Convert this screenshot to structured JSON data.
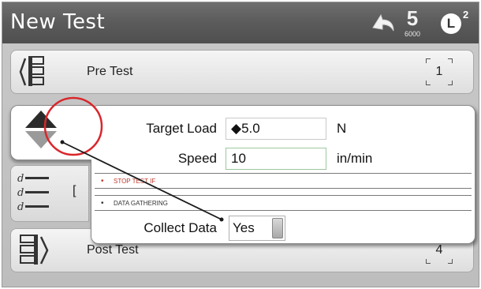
{
  "header": {
    "title": "New Test",
    "undo_icon": "undo-arrow-icon",
    "sg_icon": {
      "glyph": "5",
      "subtext": "6000"
    },
    "login": {
      "letter": "L",
      "level": "2"
    }
  },
  "sections": {
    "pre_test": {
      "label": "Pre Test",
      "count": "1",
      "icon": "pre-test-icon"
    },
    "data": {
      "clipped_label": "[",
      "icon": "data-lines-icon"
    },
    "post_test": {
      "label": "Post Test",
      "count": "4",
      "icon": "post-test-icon"
    }
  },
  "popup": {
    "target_load": {
      "label": "Target Load",
      "value": "◆5.0",
      "unit": "N"
    },
    "speed": {
      "label": "Speed",
      "value": "10",
      "unit": "in/min"
    },
    "stop_test_if": "STOP TEST IF",
    "data_gathering": "DATA GATHERING",
    "collect_data": {
      "label": "Collect Data",
      "value": "Yes"
    },
    "bullet": "•"
  },
  "colors": {
    "header": "#5c5c5c",
    "annotation_circle": "#d9262b",
    "stop_label": "#c0392b"
  }
}
